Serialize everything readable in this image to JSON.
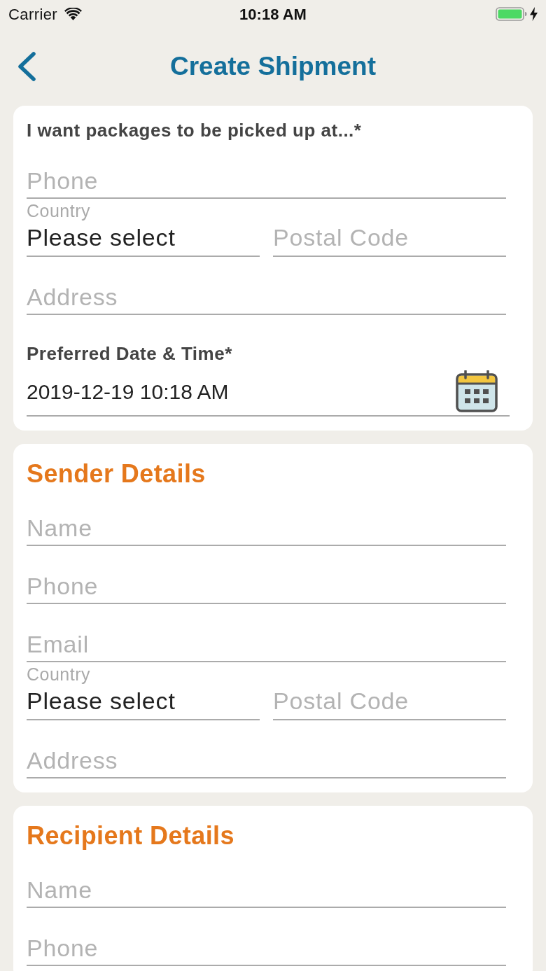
{
  "status_bar": {
    "carrier": "Carrier",
    "time": "10:18 AM"
  },
  "nav": {
    "title": "Create Shipment"
  },
  "sections": [
    {
      "kind": "prompt",
      "heading": "I want packages to be picked up at...*",
      "fields": [
        {
          "kind": "input",
          "placeholder": "Phone"
        },
        {
          "kind": "country_postal",
          "country_label": "Country",
          "country_value": "Please select",
          "postal_placeholder": "Postal Code"
        },
        {
          "kind": "input",
          "placeholder": "Address"
        },
        {
          "kind": "datetime",
          "label": "Preferred Date & Time*",
          "value": "2019-12-19 10:18 AM"
        }
      ]
    },
    {
      "kind": "group",
      "heading": "Sender Details",
      "fields": [
        {
          "kind": "input",
          "placeholder": "Name"
        },
        {
          "kind": "input",
          "placeholder": "Phone"
        },
        {
          "kind": "input",
          "placeholder": "Email"
        },
        {
          "kind": "country_postal",
          "country_label": "Country",
          "country_value": "Please select",
          "postal_placeholder": "Postal Code"
        },
        {
          "kind": "input",
          "placeholder": "Address"
        }
      ]
    },
    {
      "kind": "group",
      "heading": "Recipient Details",
      "fields": [
        {
          "kind": "input",
          "placeholder": "Name"
        },
        {
          "kind": "input",
          "placeholder": "Phone"
        }
      ]
    }
  ]
}
